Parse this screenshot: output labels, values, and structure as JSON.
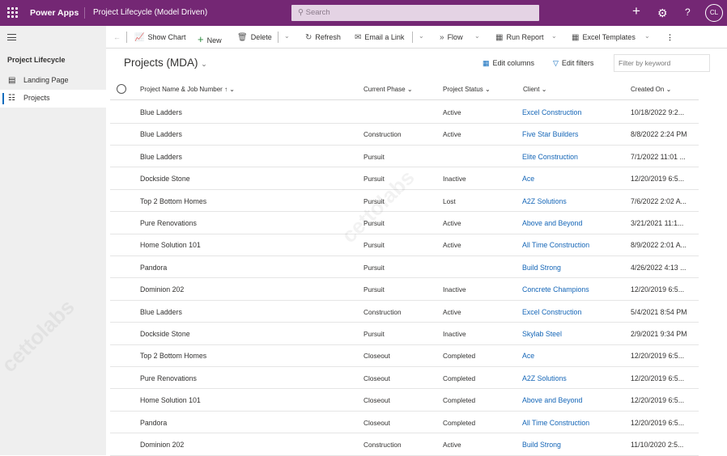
{
  "header": {
    "brand": "Power Apps",
    "app_title": "Project Lifecycle (Model Driven)",
    "search_placeholder": "Search",
    "avatar_initials": "CL",
    "icons": [
      "waffle-icon",
      "plus-icon",
      "gear-icon",
      "help-icon"
    ]
  },
  "sidebar": {
    "section_title": "Project Lifecycle",
    "items": [
      {
        "label": "Landing Page",
        "selected": false
      },
      {
        "label": "Projects",
        "selected": true
      }
    ]
  },
  "commandbar": {
    "show_chart": "Show Chart",
    "new": "New",
    "delete": "Delete",
    "refresh": "Refresh",
    "email_link": "Email a Link",
    "flow": "Flow",
    "run_report": "Run Report",
    "excel_templates": "Excel Templates"
  },
  "view": {
    "title": "Projects (MDA)",
    "edit_columns": "Edit columns",
    "edit_filters": "Edit filters",
    "filter_placeholder": "Filter by keyword"
  },
  "grid": {
    "columns": [
      "Project Name & Job Number",
      "Current Phase",
      "Project Status",
      "Client",
      "Created On"
    ],
    "rows": [
      [
        "Blue Ladders",
        "",
        "Active",
        "Excel Construction",
        "10/18/2022 9:2..."
      ],
      [
        "Blue Ladders",
        "Construction",
        "Active",
        "Five Star Builders",
        "8/8/2022 2:24 PM"
      ],
      [
        "Blue Ladders",
        "Pursuit",
        "",
        "Elite Construction",
        "7/1/2022 11:01 ..."
      ],
      [
        "Dockside Stone",
        "Pursuit",
        "Inactive",
        "Ace",
        "12/20/2019 6:5..."
      ],
      [
        "Top 2 Bottom Homes",
        "Pursuit",
        "Lost",
        "A2Z Solutions",
        "7/6/2022 2:02 A..."
      ],
      [
        "Pure Renovations",
        "Pursuit",
        "Active",
        "Above and Beyond",
        "3/21/2021 11:1..."
      ],
      [
        "Home Solution 101",
        "Pursuit",
        "Active",
        "All Time Construction",
        "8/9/2022 2:01 A..."
      ],
      [
        "Pandora",
        "Pursuit",
        "",
        "Build Strong",
        "4/26/2022 4:13 ..."
      ],
      [
        "Dominion 202",
        "Pursuit",
        "Inactive",
        "Concrete Champions",
        "12/20/2019 6:5..."
      ],
      [
        "Blue Ladders",
        "Construction",
        "Active",
        "Excel Construction",
        "5/4/2021 8:54 PM"
      ],
      [
        "Dockside Stone",
        "Pursuit",
        "Inactive",
        "Skylab Steel",
        "2/9/2021 9:34 PM"
      ],
      [
        "Top 2 Bottom Homes",
        "Closeout",
        "Completed",
        "Ace",
        "12/20/2019 6:5..."
      ],
      [
        "Pure Renovations",
        "Closeout",
        "Completed",
        "A2Z Solutions",
        "12/20/2019 6:5..."
      ],
      [
        "Home Solution 101",
        "Closeout",
        "Completed",
        "Above and Beyond",
        "12/20/2019 6:5..."
      ],
      [
        "Pandora",
        "Closeout",
        "Completed",
        "All Time Construction",
        "12/20/2019 6:5..."
      ],
      [
        "Dominion 202",
        "Construction",
        "Active",
        "Build Strong",
        "11/10/2020 2:5..."
      ]
    ]
  },
  "colors": {
    "header": "#742774",
    "link": "#1566b7",
    "accent": "#0f6cbd"
  }
}
